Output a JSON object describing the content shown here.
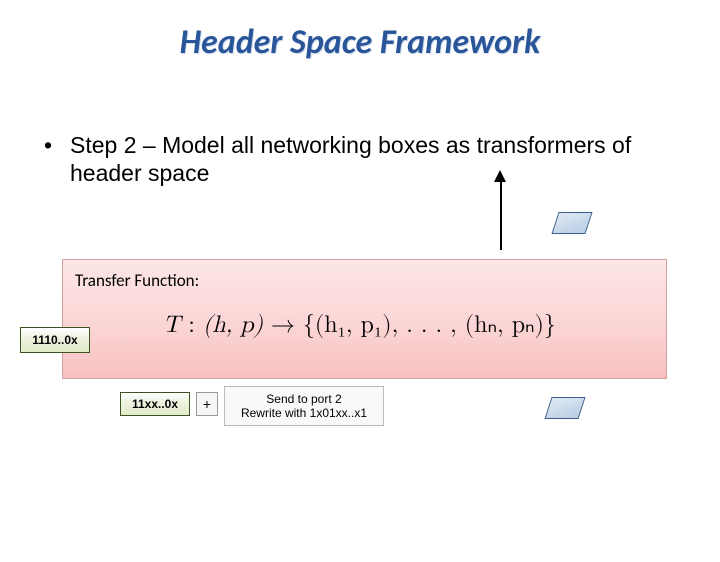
{
  "title": "Header Space Framework",
  "bullet": "Step 2 – Model all networking boxes as transformers of header space",
  "header_value": "1110..0x",
  "match_value": "11xx..0x",
  "plus": "+",
  "action": {
    "line1": "Send to port 2",
    "line2": "Rewrite with 1x01xx..x1"
  },
  "panel": {
    "label": "Transfer Function:",
    "formula": {
      "t": "T",
      "colon": " : ",
      "hp": "(h, p)",
      "arrow": " → ",
      "set": "{(h₁, p₁), . . . , (hₙ, pₙ)}"
    }
  }
}
